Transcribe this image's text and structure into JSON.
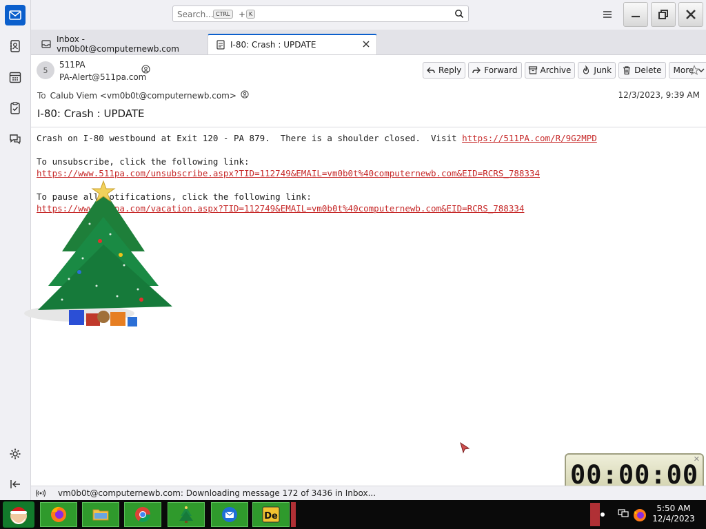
{
  "app": {
    "name": "Thunderbird"
  },
  "search": {
    "placeholder": "Search...",
    "kbd_ctrl": "CTRL",
    "plus": "+",
    "kbd_k": "K"
  },
  "tabs": [
    {
      "label": "Inbox - vm0b0t@computernewb.com",
      "active": false
    },
    {
      "label": "I-80: Crash : UPDATE",
      "active": true
    }
  ],
  "message": {
    "avatar_letter": "5",
    "sender_name": "511PA",
    "sender_email": "PA-Alert@511pa.com",
    "to_label": "To",
    "to_value": "Calub Viem <vm0b0t@computernewb.com>",
    "date": "12/3/2023, 9:39 AM",
    "subject": "I-80: Crash : UPDATE",
    "body": {
      "line1_text": "Crash on I-80 westbound at Exit 120 - PA 879.  There is a shoulder closed.  Visit ",
      "line1_link": "https://511PA.com/R/9G2MPD",
      "unsub_text": "To unsubscribe, click the following link:",
      "unsub_link": "https://www.511pa.com/unsubscribe.aspx?TID=112749&EMAIL=vm0b0t%40computernewb.com&EID=RCRS_788334",
      "pause_text": "To pause all notifications, click the following link:",
      "pause_link": "https://www.511pa.com/vacation.aspx?TID=112749&EMAIL=vm0b0t%40computernewb.com&EID=RCRS_788334"
    }
  },
  "actions": {
    "reply": "Reply",
    "forward": "Forward",
    "archive": "Archive",
    "junk": "Junk",
    "delete": "Delete",
    "more": "More"
  },
  "status": {
    "text": "vm0b0t@computernewb.com: Downloading message 172 of 3436 in Inbox..."
  },
  "timer": {
    "display": "00:00:00"
  },
  "taskbar": {
    "time": "5:50 AM",
    "date": "12/4/2023"
  },
  "colors": {
    "accent": "#0b5fcc",
    "link": "#c62828",
    "taskbar_green": "#2f9a2c"
  }
}
